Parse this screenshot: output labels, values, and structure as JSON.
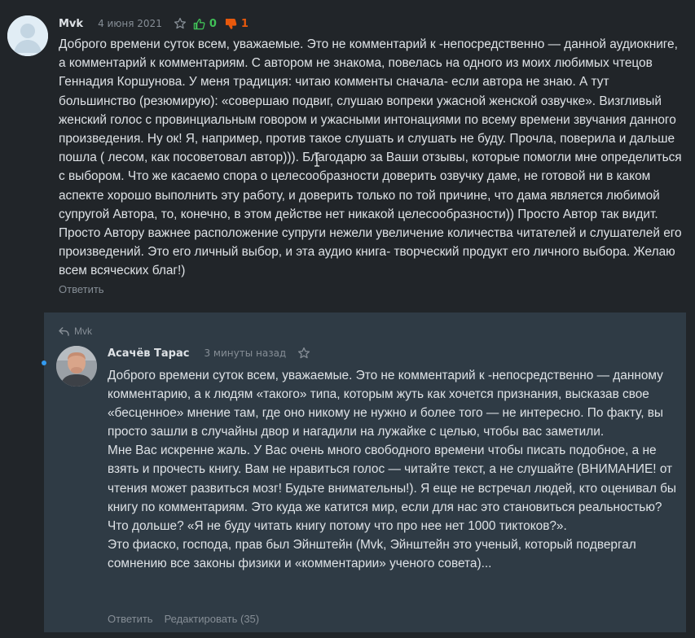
{
  "comment": {
    "author": "Mvk",
    "date": "4 июня 2021",
    "likes": "0",
    "dislikes": "1",
    "text": "Доброго времени суток всем, уважаемые. Это не комментарий к -непосредственно — данной аудиокниге, а комментарий к комментариям. С автором не знакома, повелась на одного из моих любимых чтецов Геннадия Коршунова. У меня традиция: читаю комменты сначала- если автора не знаю. А тут большинство (резюмирую): «совершаю подвиг, слушаю вопреки ужасной женской озвучке». Визгливый женский голос с провинциальным говором и ужасными интонациями по всему времени звучания данного произведения. Ну ок! Я, например, против такое слушать и слушать не буду. Прочла, поверила и дальше пошла ( лесом, как посоветовал автор))). Благодарю за Ваши отзывы, которые помогли мне определиться с выбором. Что же касаемо спора о целесообразности доверить озвучку даме, не готовой ни в каком аспекте хорошо выполнить эту работу, и доверить только по той причине, что дама является любимой супругой Автора, то, конечно, в этом действе нет никакой целесообразности)) Просто Автор так видит. Просто Автору важнее расположение супруги нежели увеличение количества читателей и слушателей его произведений. Это его личный выбор, и эта аудио книга- творческий продукт его личного выбора. Желаю всем всяческих благ!)",
    "reply_label": "Ответить"
  },
  "reply": {
    "reply_to": "Mvk",
    "author": "Асачёв Тарас",
    "date": "3 минуты назад",
    "paragraphs": [
      "Доброго времени суток всем, уважаемые. Это не комментарий к -непосредственно — данному комментарию, а к людям «такого» типа, которым жуть как хочется признания, высказав свое «бесценное» мнение там, где оно никому не нужно и более того — не интересно. По факту, вы просто зашли в случайны двор и нагадили на лужайке с целью, чтобы вас заметили.",
      "Мне Вас искренне жаль. У Вас очень много свободного времени чтобы писать подобное, а не взять и прочесть книгу. Вам не нравиться голос — читайте текст, а не слушайте (ВНИМАНИЕ! от чтения может развиться мозг! Будьте внимательны!). Я еще не встречал людей, кто оценивал бы книгу по комментариям. Это куда же катится мир, если для нас это становиться реальностью? Что дольше? «Я не буду читать книгу потому что про нее нет 1000 тиктоков?».",
      "Это фиаско, господа, прав был Эйнштейн (Mvk, Эйнштейн это ученый, который подвергал сомнению все законы физики и «комментарии» ученого совета)..."
    ],
    "reply_label": "Ответить",
    "edit_label": "Редактировать (35)"
  },
  "colors": {
    "background": "#212529",
    "reply_background": "#2f3b45",
    "like": "#40c057",
    "dislike": "#e8590c",
    "muted": "#868e96",
    "text": "#dee2e6",
    "accent_dot": "#339af0"
  },
  "icons": [
    "user-avatar-icon",
    "star-icon",
    "thumb-up-icon",
    "thumb-down-icon",
    "reply-arrow-icon",
    "text-cursor-icon"
  ]
}
